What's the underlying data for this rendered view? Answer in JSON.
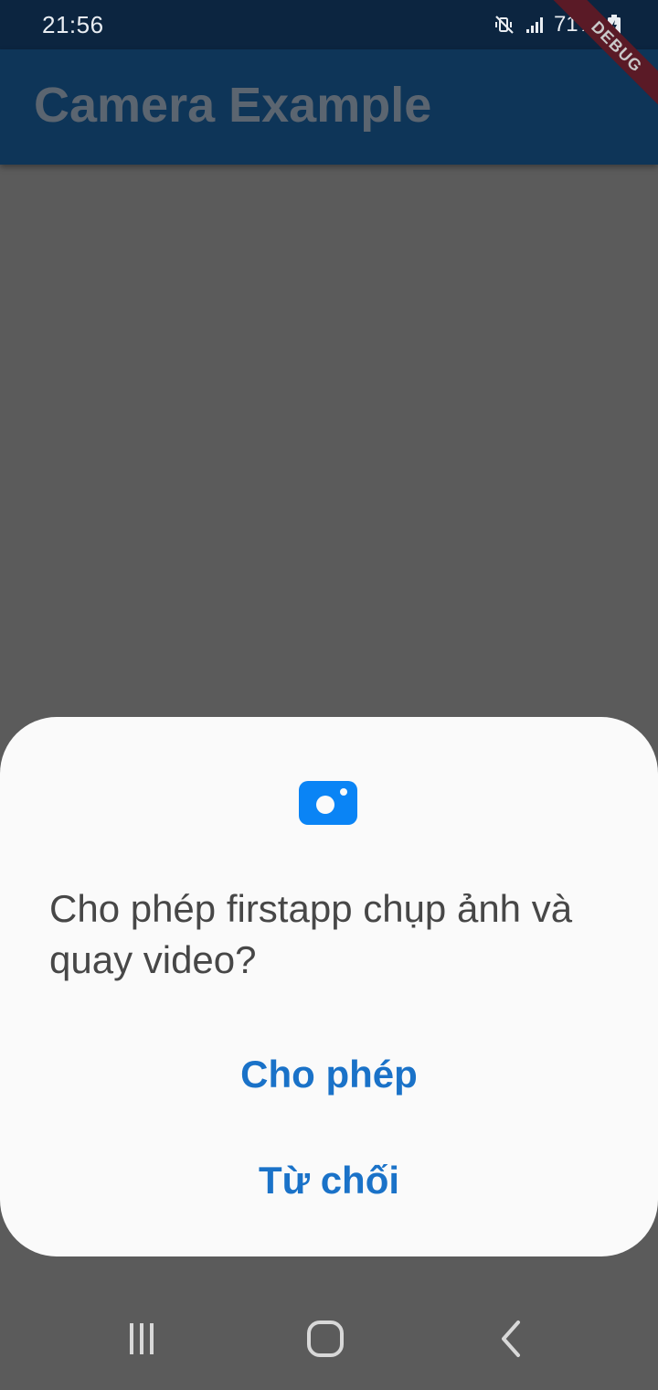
{
  "status_bar": {
    "time": "21:56",
    "battery": "71%",
    "icons": [
      "mute-vibrate-icon",
      "signal-icon",
      "battery-icon"
    ]
  },
  "debug_banner": "DEBUG",
  "app_bar": {
    "title": "Camera Example"
  },
  "permission_dialog": {
    "icon": "camera-icon",
    "message": "Cho phép firstapp chụp ảnh và quay video?",
    "allow_label": "Cho phép",
    "deny_label": "Từ chối"
  },
  "nav_bar": {
    "icons": [
      "recent-apps-icon",
      "home-icon",
      "back-icon"
    ]
  },
  "colors": {
    "status_bar": "#0c2540",
    "app_bar": "#0e3558",
    "scrim": "#5b5b5b",
    "dialog_bg": "#fafafa",
    "accent": "#1a72c8",
    "camera_icon": "#0a84f5"
  }
}
